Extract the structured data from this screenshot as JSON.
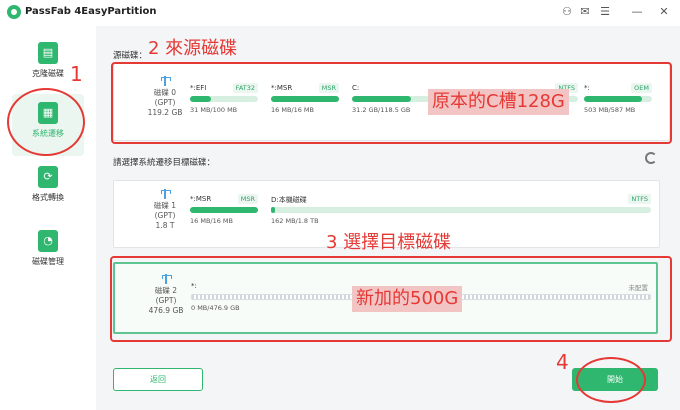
{
  "app": {
    "title": "PassFab 4EasyPartition",
    "controls": [
      "person-icon",
      "mail-icon",
      "menu-icon",
      "minimize-icon",
      "close-icon"
    ]
  },
  "sidebar": {
    "items": [
      {
        "label": "克隆磁碟",
        "icon": "clone-disk-icon",
        "active": false
      },
      {
        "label": "系統遷移",
        "icon": "system-migrate-icon",
        "active": true
      },
      {
        "label": "格式轉換",
        "icon": "format-convert-icon",
        "active": false
      },
      {
        "label": "磁碟管理",
        "icon": "disk-manage-icon",
        "active": false
      }
    ]
  },
  "source": {
    "label": "源磁碟：",
    "disk": {
      "name": "磁碟 0",
      "type": "(GPT)",
      "size": "119.2 GB"
    },
    "parts": [
      {
        "name": "*:EFI",
        "fs": "FAT32",
        "size": "31 MB/100 MB",
        "fill": 0.31
      },
      {
        "name": "*:MSR",
        "fs": "MSR",
        "size": "16 MB/16 MB",
        "fill": 1
      },
      {
        "name": "C:",
        "fs": "NTFS",
        "size": "31.2 GB/118.5 GB",
        "fill": 0.26
      },
      {
        "name": "*:",
        "fs": "OEM",
        "size": "503 MB/587 MB",
        "fill": 0.86
      }
    ]
  },
  "target": {
    "label": "請選擇系統遷移目標磁碟：",
    "disks": [
      {
        "name": "磁碟 1",
        "type": "(GPT)",
        "size": "1.8 T",
        "parts": [
          {
            "name": "*:MSR",
            "fs": "MSR",
            "size": "16 MB/16 MB",
            "fill": 1
          },
          {
            "name": "D:本機磁碟",
            "fs": "NTFS",
            "size": "162 MB/1.8 TB",
            "fill": 0.0
          }
        ]
      },
      {
        "name": "磁碟 2",
        "type": "(GPT)",
        "size": "476.9 GB",
        "selected": true,
        "parts": [
          {
            "name": "*:",
            "fs": "未配置",
            "size": "0 MB/476.9 GB"
          }
        ]
      }
    ]
  },
  "buttons": {
    "back": "返回",
    "start": "開始"
  },
  "annotations": {
    "n1": "1",
    "n2": "2 來源磁碟",
    "n3": "3  選擇目標磁碟",
    "n4": "4",
    "source_note": "原本的C槽128G",
    "target_note": "新加的500G"
  },
  "colors": {
    "accent": "#2fb66f",
    "annotation": "#e53935"
  }
}
